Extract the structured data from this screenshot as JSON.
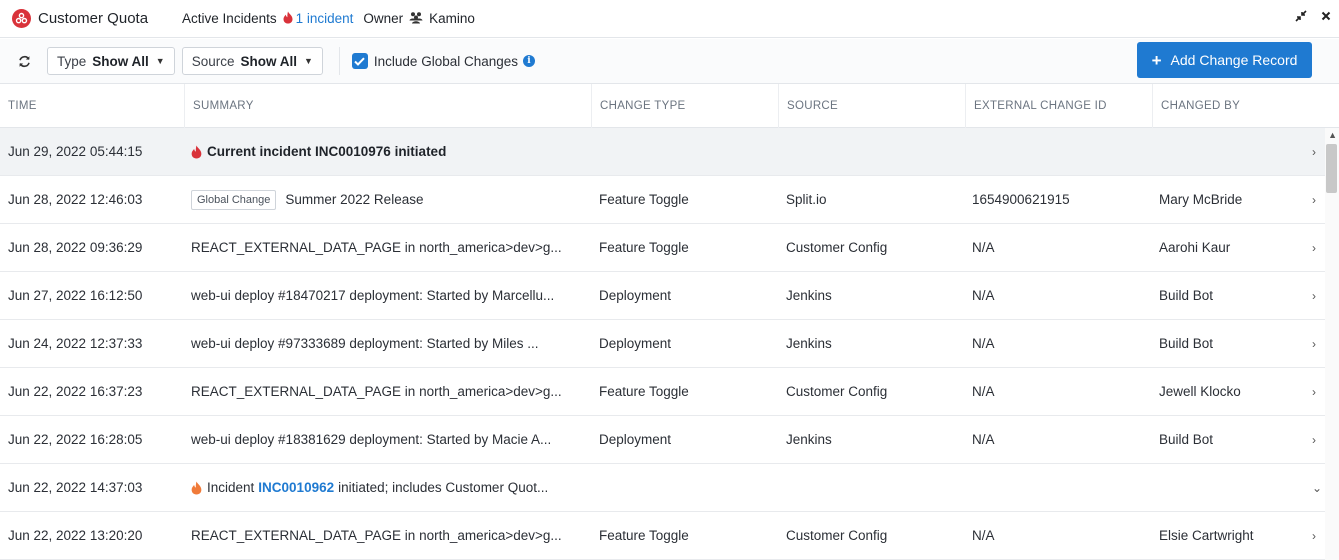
{
  "header": {
    "app_title": "Customer Quota",
    "active_incidents_label": "Active Incidents",
    "incident_count_text": "1 incident",
    "owner_label": "Owner",
    "owner_name": "Kamino",
    "collapse_icon": "collapse-arrows-icon",
    "close_icon": "close-icon"
  },
  "toolbar": {
    "type_filter": {
      "label": "Type",
      "value": "Show All"
    },
    "source_filter": {
      "label": "Source",
      "value": "Show All"
    },
    "include_global_changes": {
      "label": "Include Global Changes",
      "checked": true
    },
    "add_button_label": "Add Change Record"
  },
  "columns": [
    "TIME",
    "SUMMARY",
    "CHANGE TYPE",
    "SOURCE",
    "EXTERNAL CHANGE ID",
    "CHANGED BY"
  ],
  "rows": [
    {
      "time": "Jun 29, 2022 05:44:15",
      "summary": "Current incident INC0010976 initiated",
      "kind": "current"
    },
    {
      "time": "Jun 28, 2022 12:46:03",
      "tag": "Global Change",
      "summary": "Summer 2022 Release",
      "change_type": "Feature Toggle",
      "source": "Split.io",
      "external_id": "1654900621915",
      "changed_by": "Mary McBride"
    },
    {
      "time": "Jun 28, 2022 09:36:29",
      "summary": "REACT_EXTERNAL_DATA_PAGE in north_america>dev>g...",
      "change_type": "Feature Toggle",
      "source": "Customer Config",
      "external_id": "N/A",
      "changed_by": "Aarohi Kaur"
    },
    {
      "time": "Jun 27, 2022 16:12:50",
      "summary": "web-ui deploy #18470217 deployment: Started by Marcellu...",
      "change_type": "Deployment",
      "source": "Jenkins",
      "external_id": "N/A",
      "changed_by": "Build Bot"
    },
    {
      "time": "Jun 24, 2022 12:37:33",
      "summary": "web-ui deploy #97333689 deployment: Started by Miles ...",
      "change_type": "Deployment",
      "source": "Jenkins",
      "external_id": "N/A",
      "changed_by": "Build Bot"
    },
    {
      "time": "Jun 22, 2022 16:37:23",
      "summary": "REACT_EXTERNAL_DATA_PAGE in north_america>dev>g...",
      "change_type": "Feature Toggle",
      "source": "Customer Config",
      "external_id": "N/A",
      "changed_by": "Jewell Klocko"
    },
    {
      "time": "Jun 22, 2022 16:28:05",
      "summary": "web-ui deploy #18381629 deployment: Started by Macie A...",
      "change_type": "Deployment",
      "source": "Jenkins",
      "external_id": "N/A",
      "changed_by": "Build Bot"
    },
    {
      "time": "Jun 22, 2022 14:37:03",
      "incident_prefix": "Incident",
      "incident_link": "INC0010962",
      "incident_suffix": "initiated; includes Customer Quot...",
      "kind": "incident"
    },
    {
      "time": "Jun 22, 2022 13:20:20",
      "summary": "REACT_EXTERNAL_DATA_PAGE in north_america>dev>g...",
      "change_type": "Feature Toggle",
      "source": "Customer Config",
      "external_id": "N/A",
      "changed_by": "Elsie Cartwright"
    }
  ],
  "colors": {
    "accent": "#1f7ad1",
    "flame_red": "#d9323a",
    "flame_orange": "#f07b3a"
  }
}
